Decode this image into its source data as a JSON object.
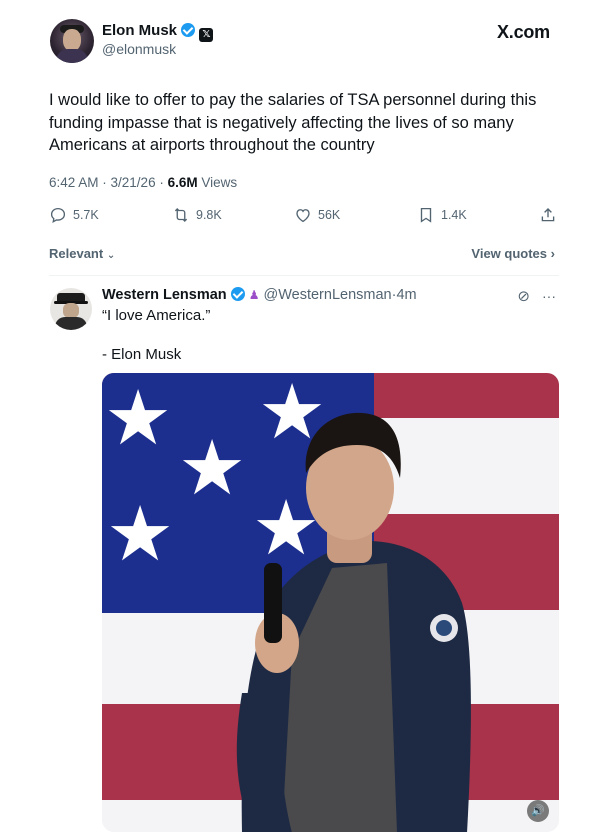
{
  "main_tweet": {
    "author_name": "Elon Musk",
    "handle": "@elonmusk",
    "site_logo": "X.com",
    "text": "I would like to offer to pay the salaries of TSA personnel during this funding impasse that is negatively affecting the lives of so many Americans at airports throughout the country",
    "time": "6:42 AM",
    "date": "3/21/26",
    "views_count": "6.6M",
    "views_label": "Views",
    "actions": {
      "replies": "5.7K",
      "reposts": "9.8K",
      "likes": "56K",
      "bookmarks": "1.4K"
    }
  },
  "filters": {
    "relevant": "Relevant",
    "view_quotes": "View quotes"
  },
  "reply": {
    "author_name": "Western Lensman",
    "handle": "@WesternLensman",
    "time": "4m",
    "line1": "“I love America.”",
    "line2": "- Elon Musk"
  },
  "colors": {
    "verified": "#1d9bf0",
    "flag_blue": "#1c2f8f",
    "flag_red": "#a8334a",
    "secondary_text": "#536471"
  }
}
